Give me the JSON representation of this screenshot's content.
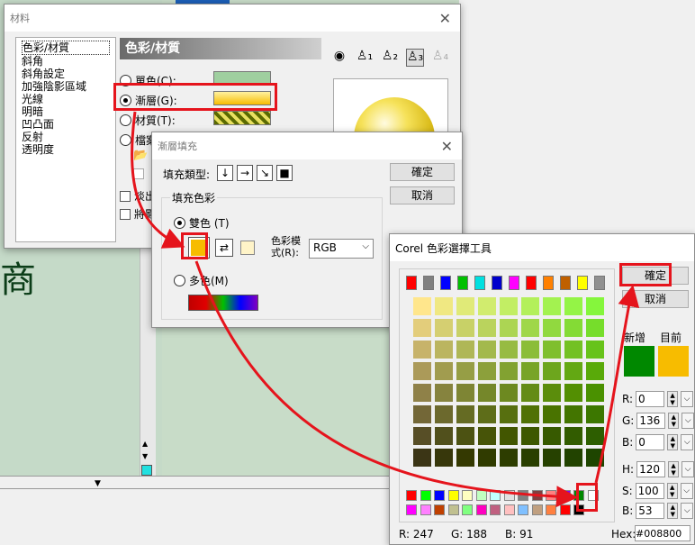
{
  "material_dialog": {
    "title": "材料",
    "categories": [
      "色彩/材質",
      "斜角",
      "斜角設定",
      "加強陰影區域",
      "光線",
      "明暗",
      "凹凸面",
      "反射",
      "透明度"
    ],
    "header": "色彩/材質",
    "options": {
      "solid": "單色(C):",
      "gradient": "漸層(G):",
      "texture": "材質(T):",
      "file": "檔案"
    },
    "checks": {
      "fade": "淡出",
      "vertical": "將影"
    }
  },
  "gradient_dialog": {
    "title": "漸層填充",
    "fill_type_label": "填充類型:",
    "ok": "確定",
    "cancel": "取消",
    "fill_color_group": "填充色彩",
    "two_color": "雙色 (T)",
    "color_mode_label": "色彩模式(R):",
    "color_mode_value": "RGB",
    "multi_color": "多色(M)",
    "color1": "#f7bc00",
    "color2": "#fff4c8"
  },
  "color_picker": {
    "title": "Corel 色彩選擇工具",
    "ok": "確定",
    "cancel": "取消",
    "new_label": "新增",
    "current_label": "目前",
    "new_color": "#008800",
    "current_color": "#f7bc00",
    "r_label": "R:",
    "g_label": "G:",
    "b_label": "B:",
    "r_value": "0",
    "g_value": "136",
    "b_value": "0",
    "h_label": "H:",
    "s_label": "S:",
    "bb_label": "B:",
    "h_value": "120",
    "s_value": "100",
    "bb_value": "53",
    "status_r": "R: 247",
    "status_g": "G: 188",
    "status_b": "B: 91",
    "hex_label": "Hex:",
    "hex_value": "#008800",
    "top_swatches": [
      "#ff0000",
      "#808080",
      "#0000ff",
      "#00c000",
      "#00e0e0",
      "#0000cc",
      "#ff00ff",
      "#ff0000",
      "#ff8000",
      "#c06000",
      "#ffff00",
      "#909090"
    ],
    "bottom_row1": [
      "#ff0000",
      "#00ff00",
      "#0000ff",
      "#ffff00",
      "#ffffc0",
      "#c0ffc0",
      "#c0ffff",
      "#e0e0e0",
      "#808080",
      "#804040",
      "#ff8080",
      "#8000ff",
      "#008800",
      "#ffffff"
    ],
    "bottom_row2": [
      "#ff00ff",
      "#ff80ff",
      "#c04000",
      "#c0c090",
      "#80ff80",
      "#ff00c0",
      "#c06080",
      "#ffc0c0",
      "#80c0ff",
      "#c0a080",
      "#ff8040",
      "#ff0000",
      "#000000"
    ]
  },
  "background": {
    "char": "商"
  },
  "icons": {
    "light_icons": [
      "light-source-icon",
      "light-1-icon",
      "light-2-icon",
      "light-3-icon",
      "light-4-icon"
    ]
  }
}
